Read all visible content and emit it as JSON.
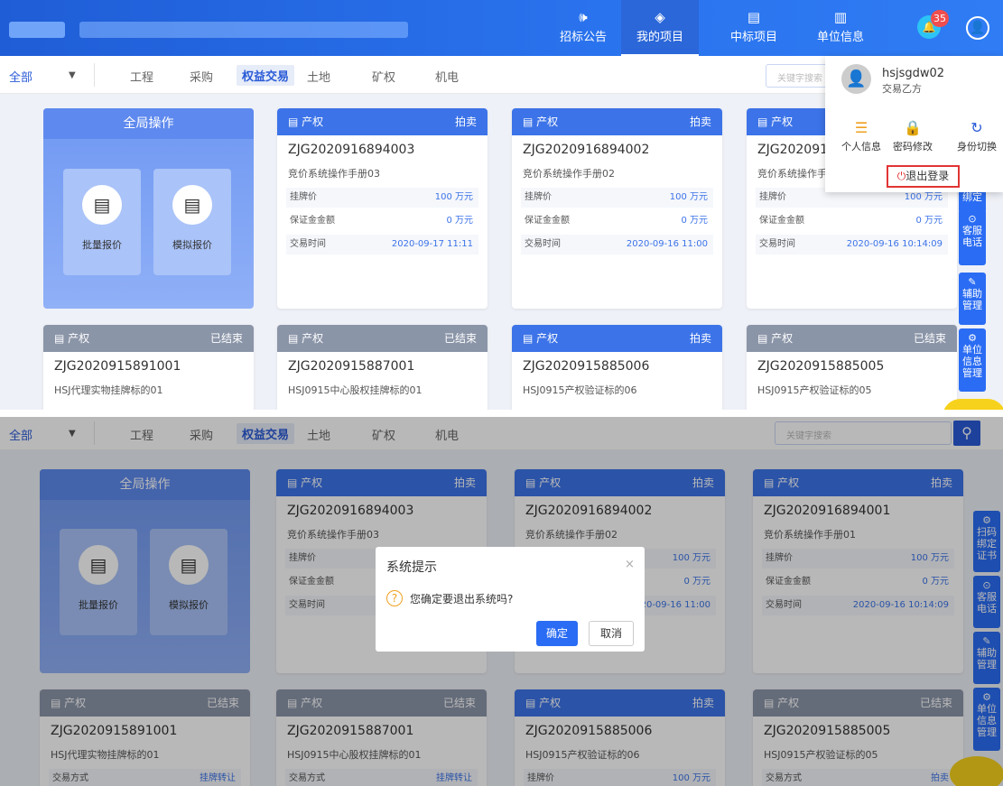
{
  "nav": {
    "items": [
      {
        "label": "招标公告",
        "icon": "speaker-icon",
        "glyph": "🕪"
      },
      {
        "label": "我的项目",
        "icon": "layers-icon",
        "glyph": "◈"
      },
      {
        "label": "中标项目",
        "icon": "document-icon",
        "glyph": "▤"
      },
      {
        "label": "单位信息",
        "icon": "building-icon",
        "glyph": "▥"
      }
    ],
    "badge_count": "35"
  },
  "categories": {
    "all": "全部",
    "items": [
      "工程",
      "采购",
      "权益交易",
      "土地",
      "矿权",
      "机电"
    ],
    "selected": "权益交易"
  },
  "search": {
    "placeholder_top": "关键字搜索",
    "placeholder": "关键字搜索"
  },
  "user_menu": {
    "username": "hsjsgdw02",
    "role": "交易乙方",
    "items": [
      "个人信息",
      "密码修改",
      "身份切换"
    ],
    "logout": "退出登录"
  },
  "global_ops": {
    "title": "全局操作",
    "batch": "批量报价",
    "simulate": "模拟报价"
  },
  "row_labels": {
    "price": "挂牌价",
    "deposit": "保证金金额",
    "time": "交易时间",
    "trade_mode": "交易方式"
  },
  "cards_top": [
    {
      "type": "产权",
      "status": "拍卖",
      "code": "ZJG2020916894003",
      "name": "竞价系统操作手册03",
      "price": "100 万元",
      "deposit": "0 万元",
      "time": "2020-09-17 11:11"
    },
    {
      "type": "产权",
      "status": "拍卖",
      "code": "ZJG2020916894002",
      "name": "竞价系统操作手册02",
      "price": "100 万元",
      "deposit": "0 万元",
      "time": "2020-09-16 11:00"
    },
    {
      "type": "产权",
      "status": "拍卖",
      "code": "ZJG2020916894001",
      "name": "竞价系统操作手册01",
      "price": "100 万元",
      "deposit": "0 万元",
      "time": "2020-09-16 10:14:09"
    }
  ],
  "cards_bottom": [
    {
      "type": "产权",
      "status": "已结束",
      "code": "ZJG2020915891001",
      "name": "HSJ代理实物挂牌标的01",
      "foot_label": "交易方式",
      "foot_value": "挂牌转让"
    },
    {
      "type": "产权",
      "status": "已结束",
      "code": "ZJG2020915887001",
      "name": "HSJ0915中心股权挂牌标的01",
      "foot_label": "交易方式",
      "foot_value": "挂牌转让"
    },
    {
      "type": "产权",
      "status": "拍卖",
      "code": "ZJG2020915885006",
      "name": "HSJ0915产权验证标的06",
      "foot_label": "挂牌价",
      "foot_value": "100 万元"
    },
    {
      "type": "产权",
      "status": "已结束",
      "code": "ZJG2020915885005",
      "name": "HSJ0915产权验证标的05",
      "foot_label": "交易方式",
      "foot_value": "拍卖"
    }
  ],
  "side_tools": {
    "scan": "扫码绑定证书",
    "service": "客服电话",
    "assist": "辅助管理",
    "unit": "单位信息管理"
  },
  "dialog": {
    "title": "系统提示",
    "message": "您确定要退出系统吗?",
    "ok": "确定",
    "cancel": "取消"
  }
}
